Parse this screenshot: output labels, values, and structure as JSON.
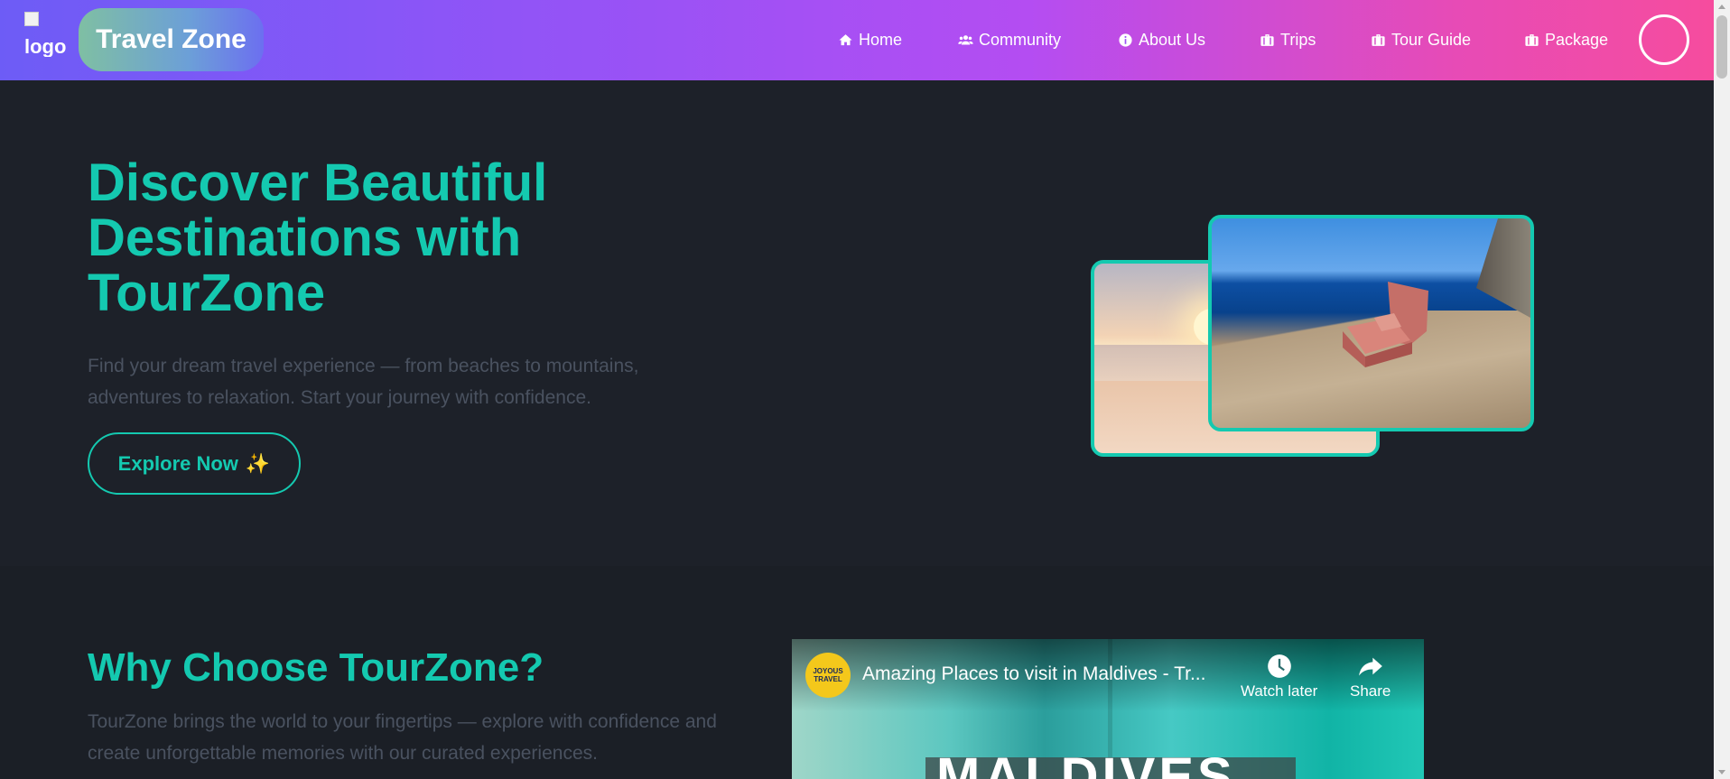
{
  "navbar": {
    "logo_alt": "logo",
    "brand": "Travel Zone",
    "items": [
      {
        "label": "Home",
        "icon": "home-icon"
      },
      {
        "label": "Community",
        "icon": "users-icon"
      },
      {
        "label": "About Us",
        "icon": "info-circle-icon"
      },
      {
        "label": "Trips",
        "icon": "suitcase-icon"
      },
      {
        "label": "Tour Guide",
        "icon": "suitcase-icon"
      },
      {
        "label": "Package",
        "icon": "suitcase-icon"
      }
    ],
    "gradient_colors": [
      "#6d5cf6",
      "#b44df2",
      "#f64c9e"
    ]
  },
  "hero": {
    "title": "Discover Beautiful Destinations with TourZone",
    "subtitle": "Find your dream travel experience — from beaches to mountains, adventures to relaxation. Start your journey with confidence.",
    "button_label": "Explore Now",
    "button_emoji": "✨",
    "accent_color": "#14c9b0"
  },
  "why": {
    "title": "Why Choose TourZone?",
    "subtitle": "TourZone brings the world to your fingertips — explore with confidence and create unforgettable memories with our curated experiences."
  },
  "video": {
    "channel": "JOYOUS TRAVEL",
    "title": "Amazing Places to visit in Maldives - Tr...",
    "watch_later": "Watch later",
    "share": "Share",
    "overlay_text": "MALDIVES"
  }
}
